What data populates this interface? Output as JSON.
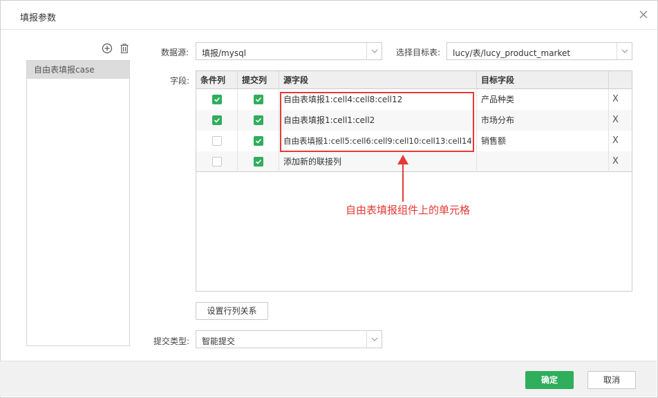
{
  "dialog": {
    "title": "填报参数"
  },
  "left_panel": {
    "case_items": [
      {
        "label": "自由表填报case"
      }
    ]
  },
  "form": {
    "datasource": {
      "label": "数据源:",
      "value": "填报/mysql"
    },
    "target_table": {
      "label": "选择目标表:",
      "value": "lucy/表/lucy_product_market"
    },
    "fields_label": "字段:",
    "submit_type": {
      "label": "提交类型:",
      "value": "智能提交"
    },
    "row_col_button": "设置行列关系"
  },
  "grid": {
    "headers": [
      "条件列",
      "提交列",
      "源字段",
      "目标字段",
      ""
    ],
    "rows": [
      {
        "condition": true,
        "submit": true,
        "source": "自由表填报1:cell4:cell8:cell12",
        "target": "产品种类",
        "delete": "X"
      },
      {
        "condition": true,
        "submit": true,
        "source": "自由表填报1:cell1:cell2",
        "target": "市场分布",
        "delete": "X"
      },
      {
        "condition": false,
        "submit": true,
        "source": "自由表填报1:cell5:cell6:cell9:cell10:cell13:cell14",
        "target": "销售额",
        "delete": "X"
      },
      {
        "condition": false,
        "submit": true,
        "source": "添加新的联接列",
        "target": "",
        "delete": "X"
      }
    ]
  },
  "annotation": {
    "text": "自由表填报组件上的单元格",
    "color": "#e53935"
  },
  "footer": {
    "ok_label": "确定",
    "cancel_label": "取消"
  },
  "colors": {
    "accent": "#2fae5b",
    "annotation": "#e53935"
  }
}
